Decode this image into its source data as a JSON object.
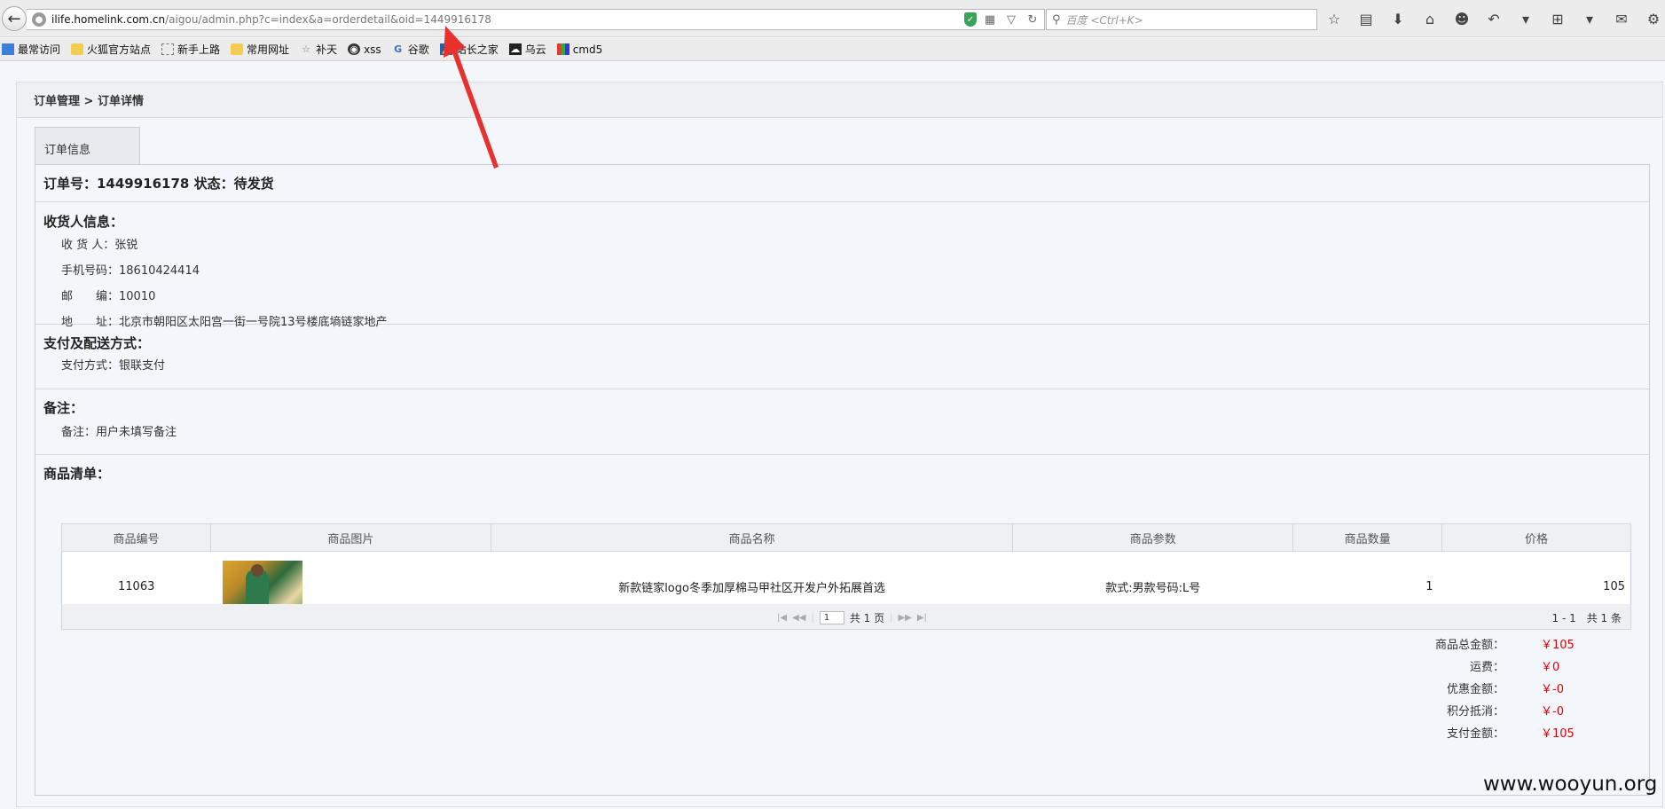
{
  "browser": {
    "url_domain": "ilife.homelink.com.cn",
    "url_prefix": "",
    "url_path": "/aigou/admin.php?c=index&a=orderdetail&oid=1449916178",
    "search_placeholder": "百度 <Ctrl+K>"
  },
  "bookmarks": [
    {
      "label": "最常访问"
    },
    {
      "label": "火狐官方站点"
    },
    {
      "label": "新手上路"
    },
    {
      "label": "常用网址"
    },
    {
      "label": "补天"
    },
    {
      "label": "xss"
    },
    {
      "label": "谷歌"
    },
    {
      "label": "站长之家"
    },
    {
      "label": "乌云"
    },
    {
      "label": "cmd5"
    }
  ],
  "breadcrumb": "订单管理 > 订单详情",
  "tab": "订单信息",
  "order": {
    "header": "订单号：1449916178 状态：待发货"
  },
  "consignee": {
    "title": "收货人信息：",
    "name_label": "收 货 人：",
    "name": "张锐",
    "phone_label": "手机号码：",
    "phone": "18610424414",
    "zip_label": "邮　　编：",
    "zip": "10010",
    "addr_label": "地　　址：",
    "addr": "北京市朝阳区太阳宫一街一号院13号楼底墒链家地产"
  },
  "payment": {
    "title": "支付及配送方式：",
    "method_label": "支付方式：",
    "method": "银联支付"
  },
  "remark": {
    "title": "备注：",
    "label": "备注：",
    "value": "用户未填写备注"
  },
  "goods": {
    "title": "商品清单：",
    "columns": [
      "商品编号",
      "商品图片",
      "商品名称",
      "商品参数",
      "商品数量",
      "价格"
    ],
    "rows": [
      {
        "id": "11063",
        "name": "新款链家logo冬季加厚棉马甲社区开发户外拓展首选",
        "params": "款式:男款号码:L号",
        "qty": "1",
        "price": "105"
      }
    ]
  },
  "pager": {
    "page_value": "1",
    "total_pages": "共 1 页",
    "summary": "1 - 1　共 1 条"
  },
  "totals": [
    {
      "label": "商品总金额：",
      "value": "￥105"
    },
    {
      "label": "运费：",
      "value": "￥0"
    },
    {
      "label": "优惠金额：",
      "value": "￥-0"
    },
    {
      "label": "积分抵消：",
      "value": "￥-0"
    },
    {
      "label": "支付金额：",
      "value": "￥105"
    }
  ],
  "watermark": "www.wooyun.org",
  "colors": {
    "price_red": "#e00000",
    "annotation_arrow": "#e8302f",
    "page_bg": "#f3f7fc"
  }
}
